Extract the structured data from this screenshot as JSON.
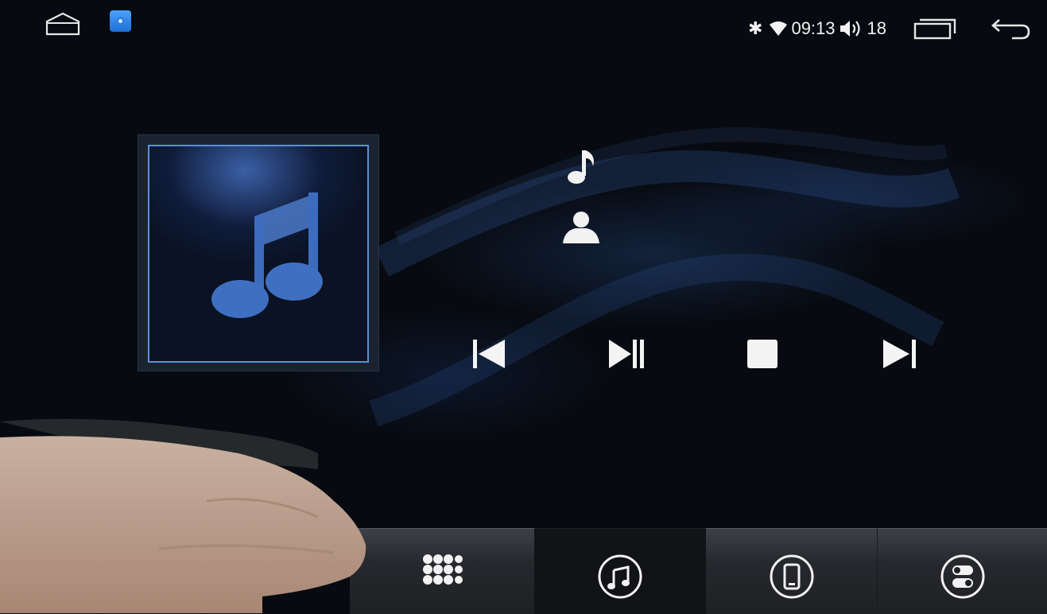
{
  "status_bar": {
    "time": "09:13",
    "volume": "18",
    "icons": [
      "home-icon",
      "app-icon",
      "bluetooth-icon",
      "wifi-icon",
      "volume-icon",
      "recents-icon",
      "back-icon"
    ]
  },
  "player": {
    "album_art_icon": "music-note-icon",
    "title_icon": "music-note-icon",
    "artist_icon": "person-icon",
    "controls": [
      "previous-icon",
      "play-pause-icon",
      "stop-icon",
      "next-icon"
    ]
  },
  "bottom_nav": {
    "tabs": [
      "apps-grid-icon",
      "music-icon",
      "phone-icon",
      "settings-toggle-icon"
    ],
    "active_tab": 1
  },
  "colors": {
    "background": "#070a10",
    "accent": "#5d8fd8",
    "tab": "#2c2e33",
    "tab_active": "#121317"
  }
}
